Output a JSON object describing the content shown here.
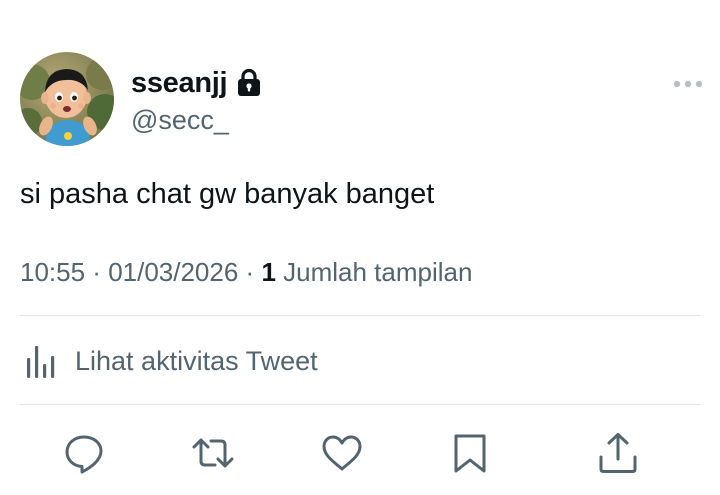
{
  "user": {
    "display_name": "sseanjj",
    "handle": "@secc_",
    "protected": true
  },
  "tweet": {
    "text": "si pasha chat gw banyak banget",
    "time": "10:55",
    "date": "01/03/2026",
    "separator": " · ",
    "views_count": "1",
    "views_label": " Jumlah tampilan"
  },
  "activity": {
    "label": "Lihat aktivitas Tweet"
  },
  "actions": [
    "reply-icon",
    "retweet-icon",
    "like-icon",
    "bookmark-icon",
    "share-icon"
  ],
  "colors": {
    "text_primary": "#0f1419",
    "text_secondary": "#536471",
    "divider": "#dfe3e6",
    "icon": "#536471"
  }
}
